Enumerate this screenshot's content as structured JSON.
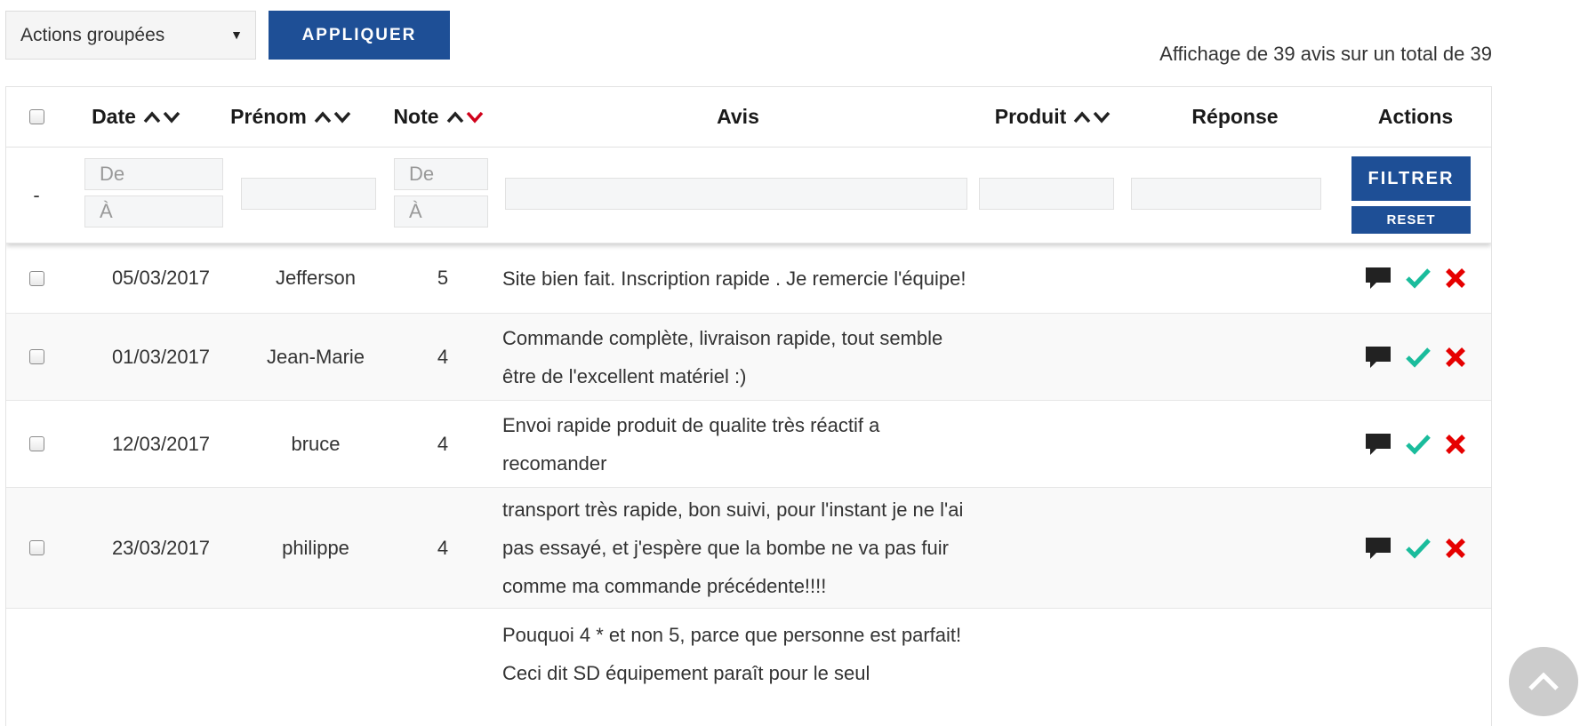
{
  "toolbar": {
    "bulk_actions_value": "Actions groupées",
    "apply_label": "APPLIQUER",
    "count_text": "Affichage de 39 avis sur un total de 39"
  },
  "table": {
    "headers": {
      "date": "Date",
      "firstname": "Prénom",
      "note": "Note",
      "review": "Avis",
      "product": "Produit",
      "response": "Réponse",
      "actions": "Actions"
    },
    "filters": {
      "checkbox_placeholder": "-",
      "date_from_placeholder": "De",
      "date_to_placeholder": "À",
      "note_from_placeholder": "De",
      "note_to_placeholder": "À",
      "filter_label": "FILTRER",
      "reset_label": "RESET"
    },
    "rows": [
      {
        "date": "05/03/2017",
        "firstname": "Jefferson",
        "note": "5",
        "review": "Site bien fait. Inscription rapide . Je remercie l'équipe!"
      },
      {
        "date": "01/03/2017",
        "firstname": "Jean-Marie",
        "note": "4",
        "review": "Commande complète, livraison rapide, tout semble être de l'excellent matériel :)"
      },
      {
        "date": "12/03/2017",
        "firstname": "bruce",
        "note": "4",
        "review": "Envoi rapide produit de qualite très réactif a recomander"
      },
      {
        "date": "23/03/2017",
        "firstname": "philippe",
        "note": "4",
        "review": "transport très rapide, bon suivi, pour l'instant je ne l'ai pas essayé, et j'espère que la bombe ne va pas fuir comme ma commande précédente!!!!"
      },
      {
        "date": "",
        "firstname": "",
        "note": "",
        "review": "Pouquoi 4 * et non 5, parce que personne est parfait! Ceci dit SD équipement paraît pour le seul"
      }
    ]
  },
  "colors": {
    "primary": "#1e4f96",
    "sort_active": "#d0021b",
    "approve": "#1abc9c",
    "delete": "#e60000",
    "reply_icon": "#222222"
  },
  "icons": {
    "sort": "sort-arrows-icon",
    "reply": "speech-bubble-icon",
    "approve": "check-icon",
    "delete": "cross-icon",
    "scroll_top": "chevron-up-icon"
  }
}
